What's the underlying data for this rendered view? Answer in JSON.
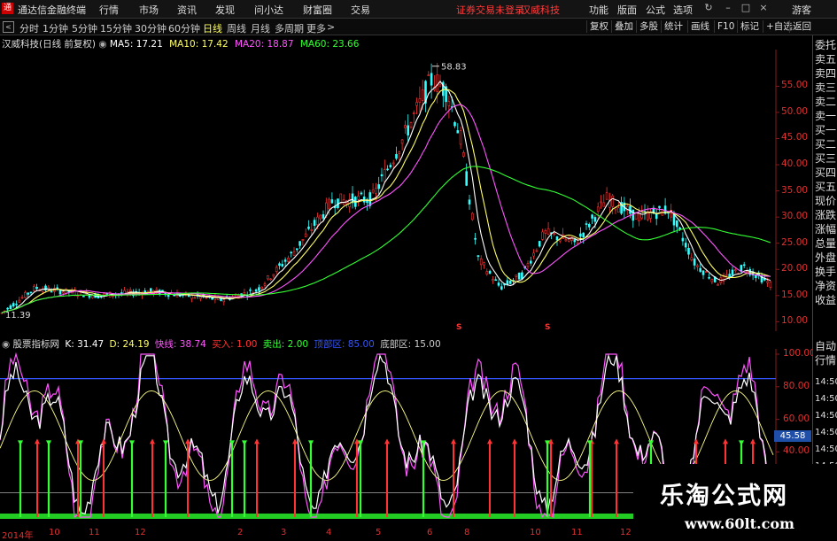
{
  "app": {
    "title": "通达信金融终端"
  },
  "menu": {
    "items": [
      "行情",
      "市场",
      "资讯",
      "发现",
      "问小达",
      "财富圈",
      "交易"
    ],
    "status_link": "证券交易未登录",
    "stock_link": "汉威科技",
    "right_items": [
      "功能",
      "版面",
      "公式",
      "选项"
    ],
    "guest": "游客"
  },
  "periods": {
    "items": [
      "分时",
      "1分钟",
      "5分钟",
      "15分钟",
      "30分钟",
      "60分钟",
      "日线",
      "周线",
      "月线",
      "多周期",
      "更多"
    ],
    "selected": "日线"
  },
  "toolbar": {
    "items": [
      "复权",
      "叠加",
      "多股",
      "统计",
      "画线",
      "F10",
      "标记",
      "+自选",
      "返回"
    ]
  },
  "main_chart": {
    "title": "汉威科技(日线 前复权)",
    "ma": [
      {
        "label": "MA5: 17.21",
        "color": "#ffffff"
      },
      {
        "label": "MA10: 17.42",
        "color": "#ffff66"
      },
      {
        "label": "MA20: 18.87",
        "color": "#ff55ff"
      },
      {
        "label": "MA60: 23.66",
        "color": "#33ff33"
      }
    ],
    "high_label": "58.83",
    "low_label": "11.39",
    "y_ticks": [
      "55.00",
      "50.00",
      "45.00",
      "40.00",
      "35.00",
      "30.00",
      "25.00",
      "20.00",
      "15.00",
      "10.00"
    ],
    "y_range": [
      8.2,
      62.0
    ]
  },
  "indicator": {
    "name": "股票指标网",
    "params": [
      {
        "label": "K: 31.47",
        "color": "#ffffff"
      },
      {
        "label": "D: 24.19",
        "color": "#ffff66"
      },
      {
        "label": "快线: 38.74",
        "color": "#ff55ff"
      },
      {
        "label": "买入: 1.00",
        "color": "#ff3333"
      },
      {
        "label": "卖出: 2.00",
        "color": "#33ff33"
      },
      {
        "label": "顶部区: 85.00",
        "color": "#3355ff"
      },
      {
        "label": "底部区: 15.00",
        "color": "#cccccc"
      }
    ],
    "y_ticks": [
      "100.00",
      "80.00",
      "60.00",
      "40.00"
    ],
    "k_badge": "45.58"
  },
  "right_panel": {
    "items": [
      "委托",
      "卖五",
      "卖四",
      "卖三",
      "卖二",
      "卖一",
      "买一",
      "买二",
      "买三",
      "买四",
      "买五",
      "现价",
      "涨跌",
      "涨幅",
      "总量",
      "外盘",
      "换手",
      "净资",
      "收益",
      "自动",
      "行情"
    ],
    "times": [
      "14:50",
      "14:50",
      "14:50",
      "14:50",
      "14:50",
      "14:50",
      "14:50",
      "14:50"
    ]
  },
  "date_axis": [
    "2014年",
    "10",
    "11",
    "12",
    "2",
    "3",
    "4",
    "5",
    "6",
    "8",
    "10",
    "11",
    "12"
  ],
  "watermark": {
    "title": "乐淘公式网",
    "url": "www.60lt.com"
  },
  "colors": {
    "up": "#ff3333",
    "down": "#33ff33",
    "axis": "#e03030",
    "top_line": "#3355ff"
  }
}
